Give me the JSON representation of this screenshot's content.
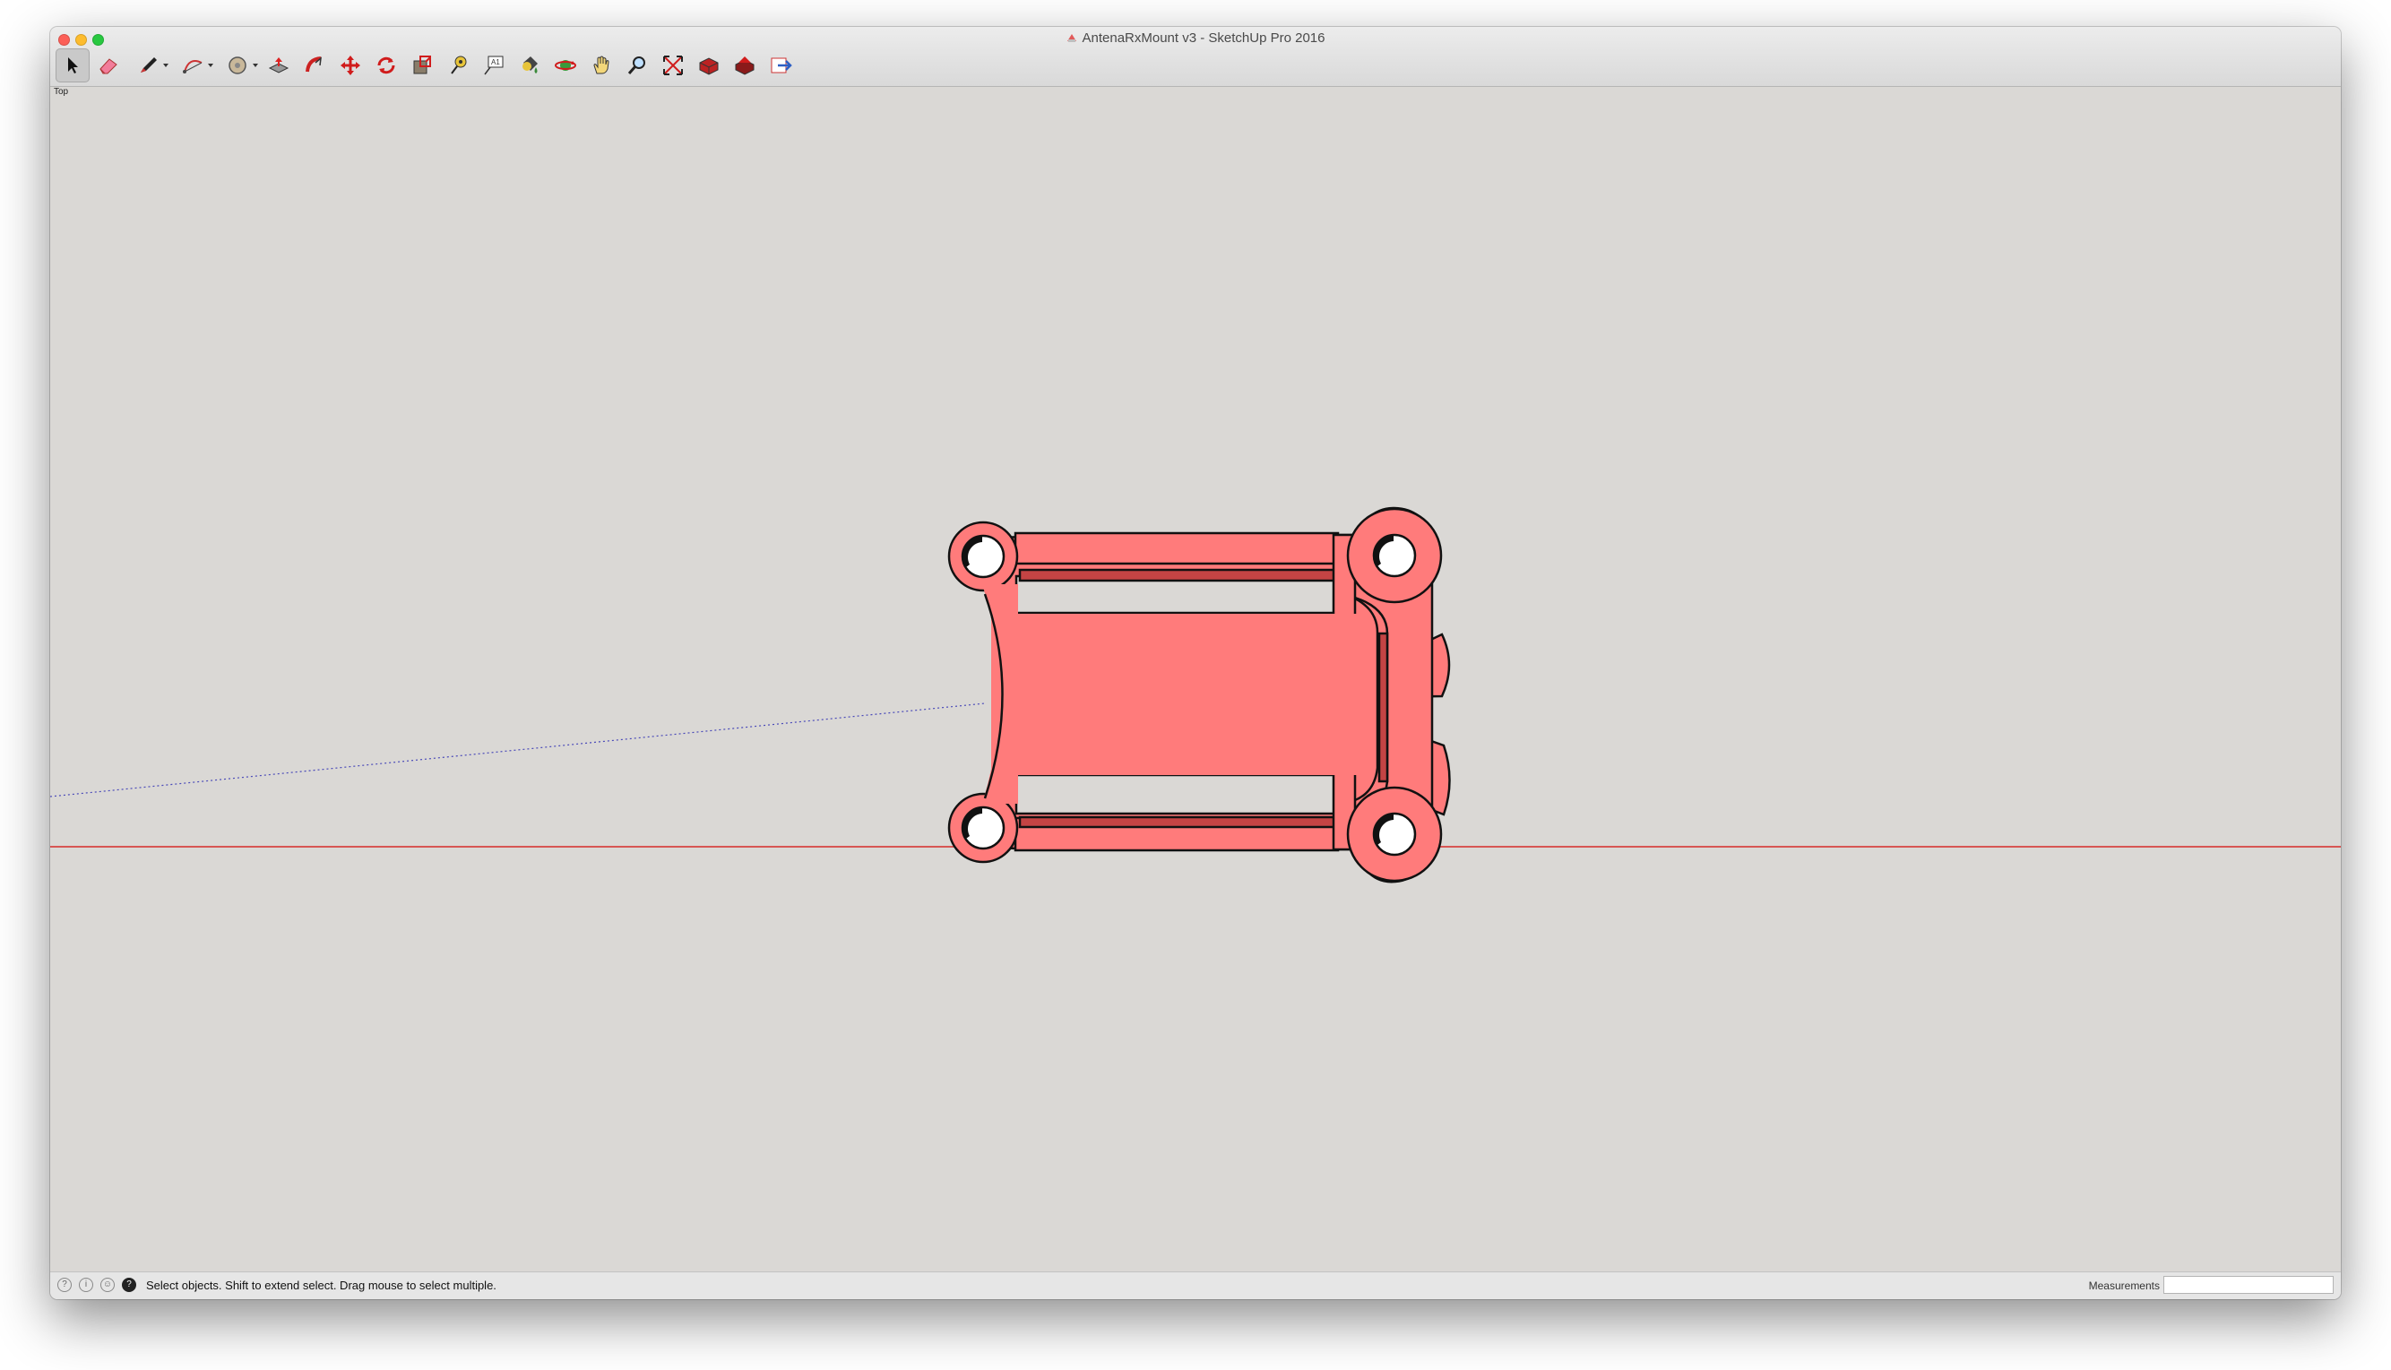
{
  "window": {
    "title": "AntenaRxMount v3 - SketchUp Pro 2016"
  },
  "toolbar": {
    "tools": [
      {
        "id": "select",
        "icon": "select-arrow-icon",
        "active": true
      },
      {
        "id": "eraser",
        "icon": "eraser-icon"
      },
      {
        "id": "line",
        "icon": "pencil-icon",
        "dropdown": true
      },
      {
        "id": "arc",
        "icon": "arc-icon",
        "dropdown": true
      },
      {
        "id": "shapes",
        "icon": "circle-shape-icon",
        "dropdown": true
      },
      {
        "id": "push-pull",
        "icon": "push-pull-icon"
      },
      {
        "id": "offset",
        "icon": "follow-me-icon"
      },
      {
        "id": "move",
        "icon": "move-icon"
      },
      {
        "id": "rotate",
        "icon": "rotate-icon"
      },
      {
        "id": "scale",
        "icon": "scale-icon"
      },
      {
        "id": "tape",
        "icon": "tape-measure-icon"
      },
      {
        "id": "text",
        "icon": "text-label-icon"
      },
      {
        "id": "paint",
        "icon": "paint-bucket-icon"
      },
      {
        "id": "orbit",
        "icon": "orbit-icon"
      },
      {
        "id": "pan",
        "icon": "pan-hand-icon"
      },
      {
        "id": "zoom",
        "icon": "zoom-icon"
      },
      {
        "id": "zoom-extents",
        "icon": "zoom-extents-icon"
      },
      {
        "id": "warehouse",
        "icon": "3d-warehouse-icon"
      },
      {
        "id": "extension",
        "icon": "extension-warehouse-icon"
      },
      {
        "id": "send",
        "icon": "send-to-layout-icon"
      }
    ]
  },
  "viewport": {
    "scene_label": "Top",
    "model_color": "#ff7b7b",
    "axis_color": "#d62a2a",
    "background": "#dad8d5"
  },
  "statusbar": {
    "message": "Select objects. Shift to extend select. Drag mouse to select multiple.",
    "measurements_label": "Measurements",
    "measurements_value": ""
  }
}
